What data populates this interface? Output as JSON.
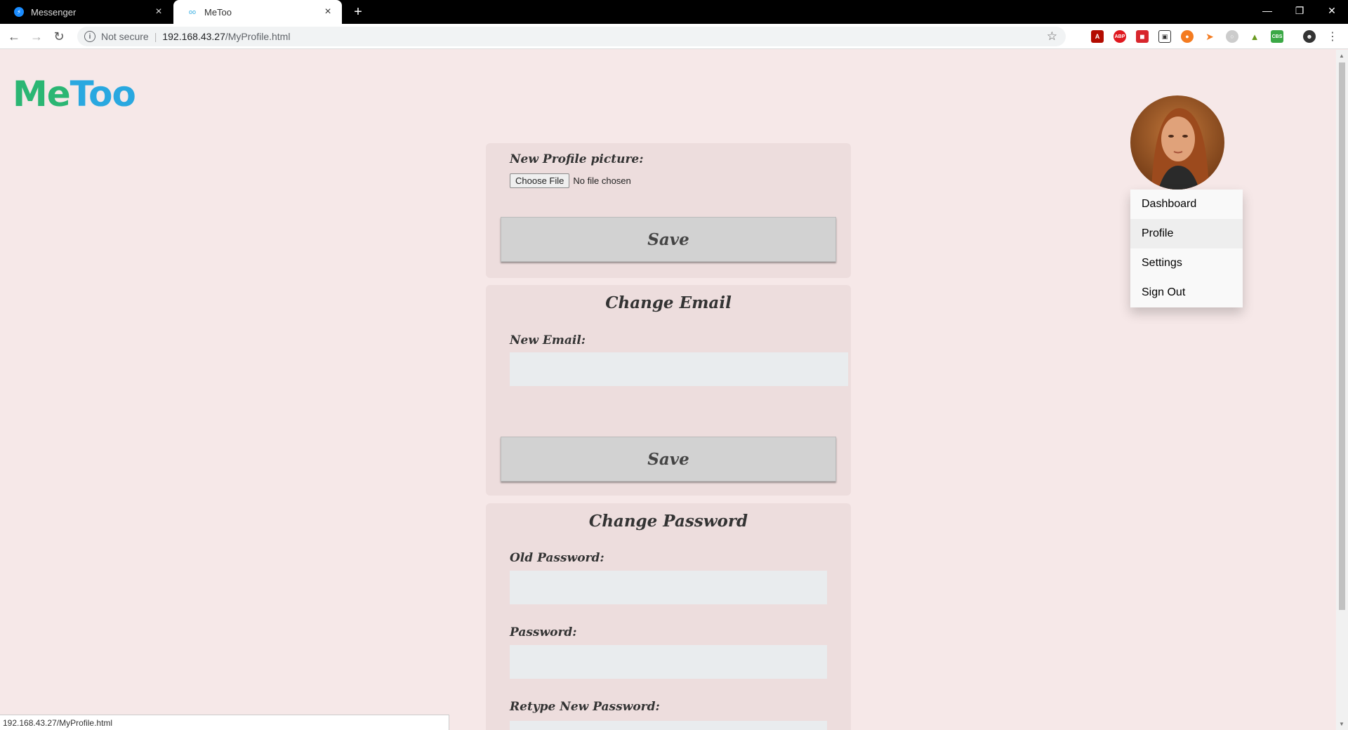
{
  "browser": {
    "tabs": [
      {
        "title": "Messenger",
        "active": false
      },
      {
        "title": "MeToo",
        "active": true
      }
    ],
    "security_label": "Not secure",
    "url_host": "192.168.43.27",
    "url_path": "/MyProfile.html",
    "status_url": "192.168.43.27/MyProfile.html",
    "extensions": [
      "acrobat",
      "abp",
      "ext-red",
      "box",
      "ext-orange",
      "ext-fox",
      "ext-gray",
      "ext-green",
      "ext-cbs"
    ],
    "ext_labels": {
      "abp": "ABP",
      "cbs": "CBS"
    }
  },
  "site": {
    "logo_me": "Me",
    "logo_too": "Too"
  },
  "menu": {
    "items": [
      "Dashboard",
      "Profile",
      "Settings",
      "Sign Out"
    ]
  },
  "profile_picture": {
    "label": "New Profile picture:",
    "choose_file": "Choose File",
    "no_file": "No file chosen",
    "save": "Save"
  },
  "change_email": {
    "title": "Change Email",
    "label": "New Email:",
    "value": "",
    "save": "Save"
  },
  "change_password": {
    "title": "Change Password",
    "old_label": "Old Password:",
    "new_label": "Password:",
    "retype_label": "Retype New Password:"
  },
  "colors": {
    "page_bg": "#f6e8e8",
    "logo_green": "#2bb673",
    "logo_blue": "#29a8e0"
  }
}
